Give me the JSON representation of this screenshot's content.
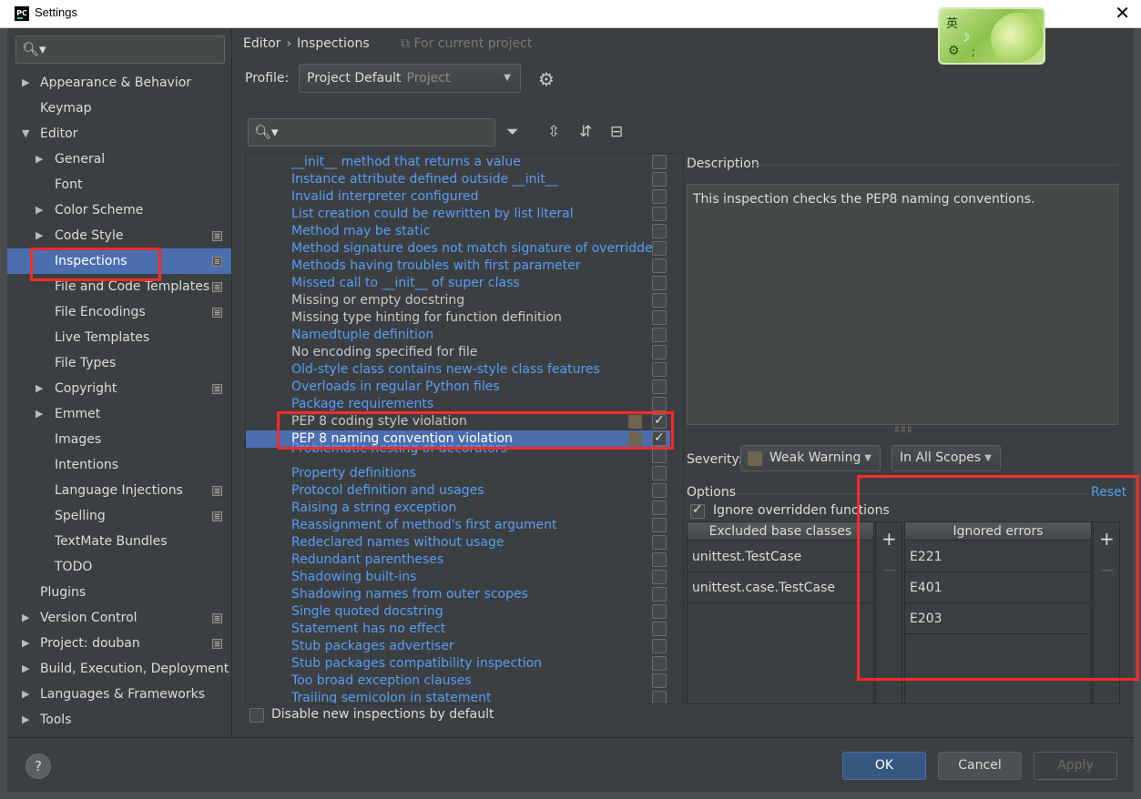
{
  "window": {
    "title": "Settings",
    "app_icon_text": "PC",
    "close_glyph": "✕"
  },
  "ime": {
    "char": "英",
    "moon": "☽",
    "gear": "⚙",
    "dot": ";"
  },
  "sidebar": {
    "search_icon": "🔍︎▾",
    "items": [
      {
        "label": "Appearance & Behavior",
        "arrow": "▶",
        "level": 0,
        "project": false
      },
      {
        "label": "Keymap",
        "arrow": "",
        "level": 0,
        "project": false
      },
      {
        "label": "Editor",
        "arrow": "▼",
        "level": 0,
        "project": false
      },
      {
        "label": "General",
        "arrow": "▶",
        "level": 1,
        "project": false
      },
      {
        "label": "Font",
        "arrow": "",
        "level": 1,
        "project": false
      },
      {
        "label": "Color Scheme",
        "arrow": "▶",
        "level": 1,
        "project": false
      },
      {
        "label": "Code Style",
        "arrow": "▶",
        "level": 1,
        "project": true
      },
      {
        "label": "Inspections",
        "arrow": "",
        "level": 1,
        "project": true,
        "selected": true
      },
      {
        "label": "File and Code Templates",
        "arrow": "",
        "level": 1,
        "project": true
      },
      {
        "label": "File Encodings",
        "arrow": "",
        "level": 1,
        "project": true
      },
      {
        "label": "Live Templates",
        "arrow": "",
        "level": 1,
        "project": false
      },
      {
        "label": "File Types",
        "arrow": "",
        "level": 1,
        "project": false
      },
      {
        "label": "Copyright",
        "arrow": "▶",
        "level": 1,
        "project": true
      },
      {
        "label": "Emmet",
        "arrow": "▶",
        "level": 1,
        "project": false
      },
      {
        "label": "Images",
        "arrow": "",
        "level": 1,
        "project": false
      },
      {
        "label": "Intentions",
        "arrow": "",
        "level": 1,
        "project": false
      },
      {
        "label": "Language Injections",
        "arrow": "",
        "level": 1,
        "project": true
      },
      {
        "label": "Spelling",
        "arrow": "",
        "level": 1,
        "project": true
      },
      {
        "label": "TextMate Bundles",
        "arrow": "",
        "level": 1,
        "project": false
      },
      {
        "label": "TODO",
        "arrow": "",
        "level": 1,
        "project": false
      },
      {
        "label": "Plugins",
        "arrow": "",
        "level": 0,
        "project": false
      },
      {
        "label": "Version Control",
        "arrow": "▶",
        "level": 0,
        "project": true
      },
      {
        "label": "Project: douban",
        "arrow": "▶",
        "level": 0,
        "project": true
      },
      {
        "label": "Build, Execution, Deployment",
        "arrow": "▶",
        "level": 0,
        "project": false
      },
      {
        "label": "Languages & Frameworks",
        "arrow": "▶",
        "level": 0,
        "project": false
      },
      {
        "label": "Tools",
        "arrow": "▶",
        "level": 0,
        "project": false
      }
    ]
  },
  "header": {
    "breadcrumb_1": "Editor",
    "breadcrumb_sep": "›",
    "breadcrumb_2": "Inspections",
    "scope_note": "⧉ For current project",
    "profile_label": "Profile:",
    "profile_value": "Project Default",
    "profile_sub": "Project",
    "caret": "▼",
    "gear_glyph": "⚙"
  },
  "toolbar": {
    "search_icon": "🔍︎▾",
    "filter_glyph": "⏷",
    "expand_glyph": "⇳",
    "collapse_glyph": "⇵",
    "reset_glyph": "⊟"
  },
  "inspections": [
    {
      "label": "__init__ method that returns a value",
      "style": "blue",
      "checked": false
    },
    {
      "label": "Instance attribute defined outside __init__",
      "style": "blue",
      "checked": false
    },
    {
      "label": "Invalid interpreter configured",
      "style": "blue",
      "checked": false
    },
    {
      "label": "List creation could be rewritten by list literal",
      "style": "blue",
      "checked": false
    },
    {
      "label": "Method may be static",
      "style": "blue",
      "checked": false
    },
    {
      "label": "Method signature does not match signature of overridden",
      "style": "blue",
      "checked": false
    },
    {
      "label": "Methods having troubles with first parameter",
      "style": "blue",
      "checked": false
    },
    {
      "label": "Missed call to __init__ of super class",
      "style": "blue",
      "checked": false
    },
    {
      "label": "Missing or empty docstring",
      "style": "gray",
      "checked": false
    },
    {
      "label": "Missing type hinting for function definition",
      "style": "gray",
      "checked": false
    },
    {
      "label": "Namedtuple definition",
      "style": "blue",
      "checked": false
    },
    {
      "label": "No encoding specified for file",
      "style": "gray",
      "checked": false
    },
    {
      "label": "Old-style class contains new-style class features",
      "style": "blue",
      "checked": false
    },
    {
      "label": "Overloads in regular Python files",
      "style": "blue",
      "checked": false
    },
    {
      "label": "Package requirements",
      "style": "blue",
      "checked": false
    },
    {
      "label": "PEP 8 coding style violation",
      "style": "gray",
      "checked": true,
      "swatch": true
    },
    {
      "label": "PEP 8 naming convention violation",
      "style": "sel",
      "checked": true,
      "swatch": true
    },
    {
      "label": "Problematic nesting of decorators",
      "style": "blue",
      "checked": false,
      "clip": true
    },
    {
      "label": "Property definitions",
      "style": "blue",
      "checked": false
    },
    {
      "label": "Protocol definition and usages",
      "style": "blue",
      "checked": false
    },
    {
      "label": "Raising a string exception",
      "style": "blue",
      "checked": false
    },
    {
      "label": "Reassignment of method's first argument",
      "style": "blue",
      "checked": false
    },
    {
      "label": "Redeclared names without usage",
      "style": "blue",
      "checked": false
    },
    {
      "label": "Redundant parentheses",
      "style": "blue",
      "checked": false
    },
    {
      "label": "Shadowing built-ins",
      "style": "blue",
      "checked": false
    },
    {
      "label": "Shadowing names from outer scopes",
      "style": "blue",
      "checked": false
    },
    {
      "label": "Single quoted docstring",
      "style": "blue",
      "checked": false
    },
    {
      "label": "Statement has no effect",
      "style": "blue",
      "checked": false
    },
    {
      "label": "Stub packages advertiser",
      "style": "blue",
      "checked": false
    },
    {
      "label": "Stub packages compatibility inspection",
      "style": "blue",
      "checked": false
    },
    {
      "label": "Too broad exception clauses",
      "style": "blue",
      "checked": false
    },
    {
      "label": "Trailing semicolon in statement",
      "style": "blue",
      "checked": false
    }
  ],
  "disable_new": {
    "label": "Disable new inspections by default",
    "checked": false
  },
  "description": {
    "label": "Description",
    "text": "This inspection checks the PEP8 naming conventions.",
    "grip": "⠿⠿⠿"
  },
  "severity": {
    "label": "Severity:",
    "value": "Weak Warning",
    "scope": "In All Scopes",
    "swatch_color": "#6e6450",
    "caret": "▼"
  },
  "options": {
    "label": "Options",
    "reset": "Reset",
    "ignore_overridden": "Ignore overridden functions",
    "excluded_header": "Excluded base classes",
    "excluded": [
      "unittest.TestCase",
      "unittest.case.TestCase"
    ],
    "ignored_header": "Ignored errors",
    "ignored": [
      "E221",
      "E401",
      "E203"
    ],
    "plus": "+",
    "minus": "−"
  },
  "footer": {
    "help": "?",
    "ok": "OK",
    "cancel": "Cancel",
    "apply": "Apply"
  },
  "colors": {
    "accent_selection": "#4b6eaf",
    "link_blue": "#589df6",
    "highlight_red": "#ff2a2a",
    "background": "#3c3f41"
  }
}
